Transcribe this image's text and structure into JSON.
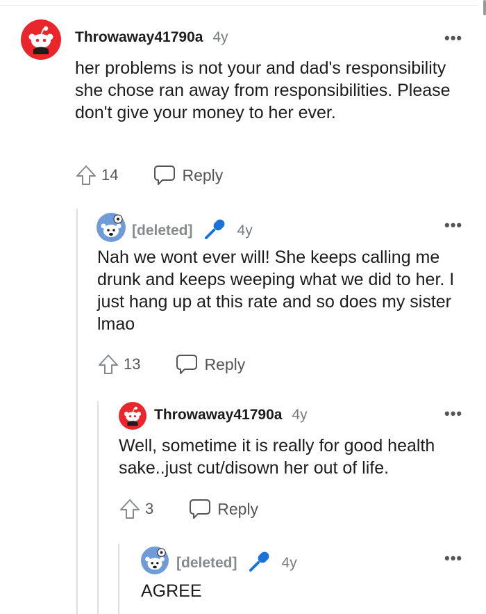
{
  "comments": [
    {
      "username": "Throwaway41790a",
      "age": "4y",
      "text": "her problems is not your and dad's responsibility she chose ran away from responsibilities. Please don't give your money to her ever.",
      "votes": "14",
      "reply_label": "Reply",
      "more_label": "•••"
    },
    {
      "username": "[deleted]",
      "age": "4y",
      "text": "Nah we wont ever will! She keeps calling me drunk and keeps weeping what we did to her. I just hang up at this rate and so does my sister lmao",
      "votes": "13",
      "reply_label": "Reply",
      "more_label": "•••"
    },
    {
      "username": "Throwaway41790a",
      "age": "4y",
      "text": "Well, sometime it is really for good health sake..just cut/disown her out of life.",
      "votes": "3",
      "reply_label": "Reply",
      "more_label": "•••"
    },
    {
      "username": "[deleted]",
      "age": "4y",
      "text": "AGREE",
      "more_label": "•••"
    }
  ],
  "icons": {
    "upvote": "upvote-arrow-icon",
    "reply": "speech-bubble-icon",
    "mic": "microphone-icon",
    "more": "ellipsis-icon"
  },
  "colors": {
    "snoo_red": "#e8262b",
    "deleted_avatar_blue": "#6f9bd8",
    "mic_blue": "#1a73d9",
    "thread_line": "#dedede"
  }
}
